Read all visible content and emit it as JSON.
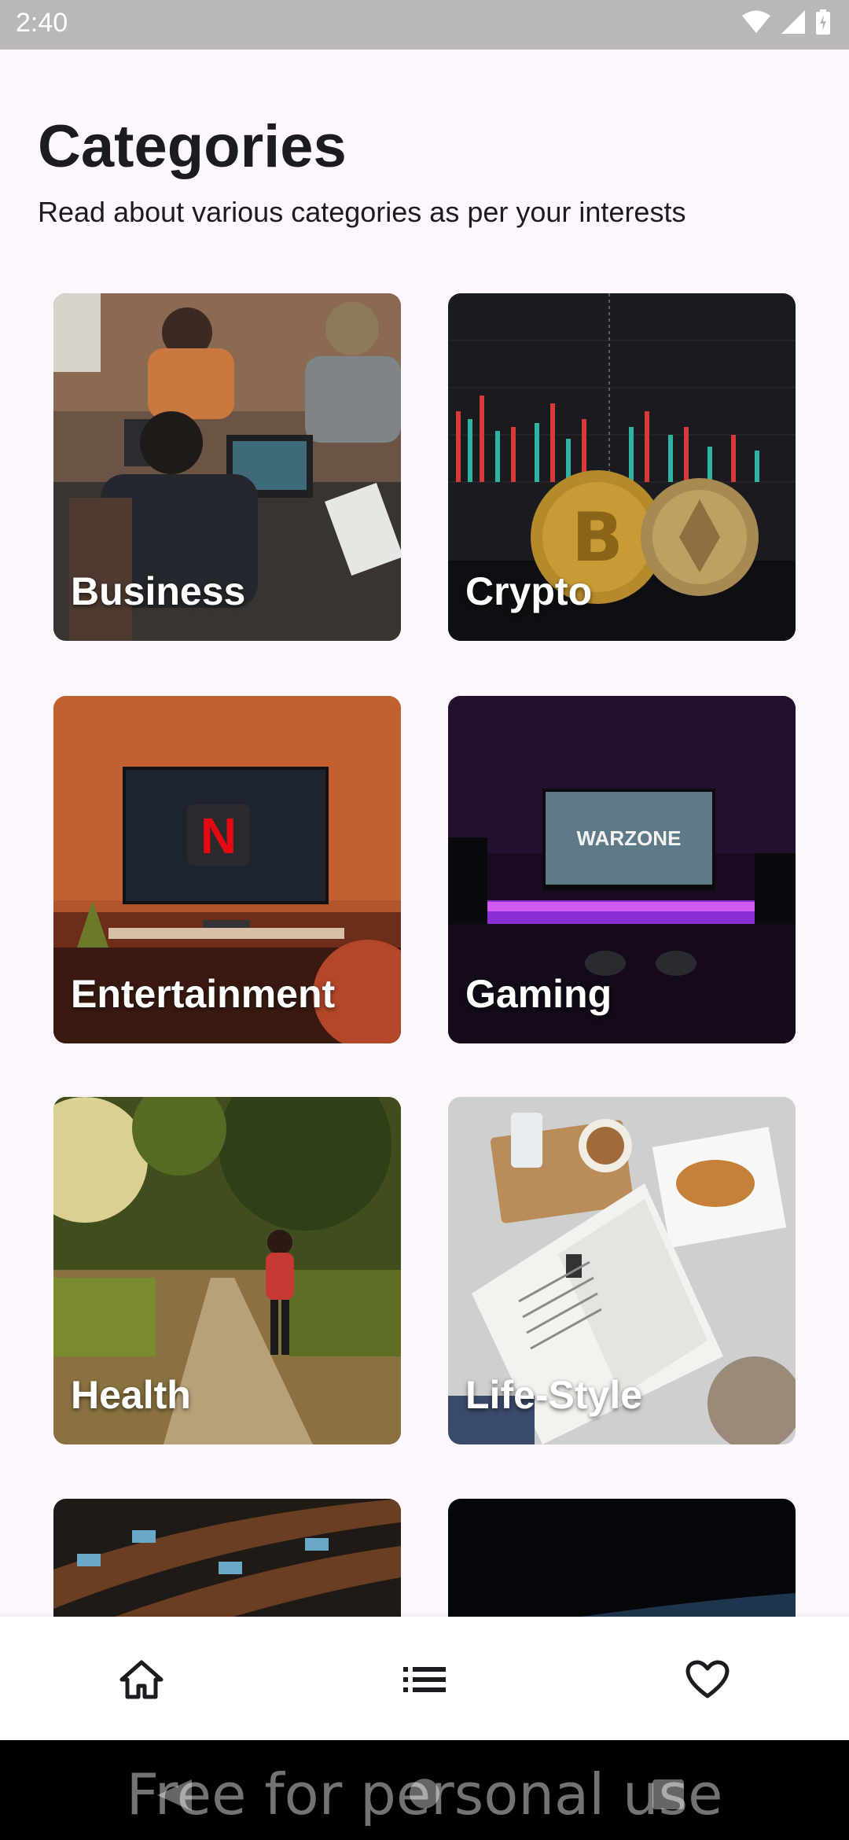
{
  "status_bar": {
    "time": "2:40"
  },
  "page": {
    "title": "Categories",
    "subtitle": "Read about various categories as per your interests"
  },
  "categories": [
    {
      "label": "Business"
    },
    {
      "label": "Crypto"
    },
    {
      "label": "Entertainment"
    },
    {
      "label": "Gaming"
    },
    {
      "label": "Health"
    },
    {
      "label": "Life-Style"
    },
    {
      "label": ""
    },
    {
      "label": ""
    }
  ],
  "bottom_nav": {
    "items": [
      {
        "icon": "home-icon"
      },
      {
        "icon": "list-icon"
      },
      {
        "icon": "heart-icon"
      }
    ]
  },
  "watermark": "Free for personal use"
}
